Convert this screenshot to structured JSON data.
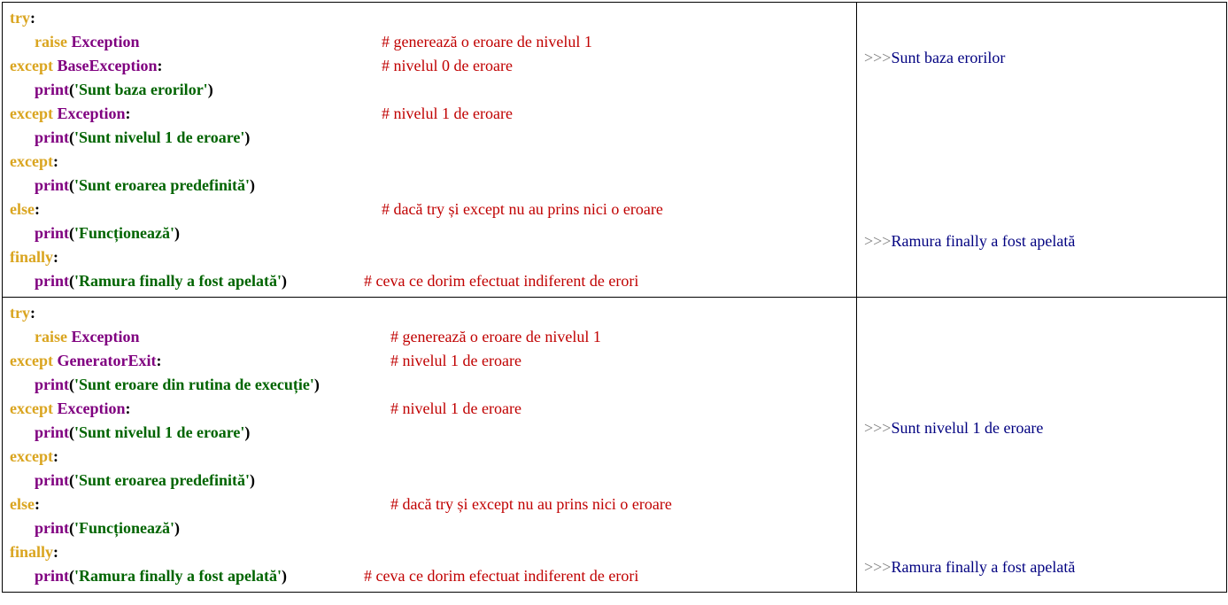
{
  "ex1": {
    "code": {
      "l1": {
        "kw": "try",
        "colon": ":"
      },
      "l2": {
        "kw": "raise",
        "exc": "Exception",
        "comment": "# generează o eroare de nivelul 1"
      },
      "l3": {
        "kw": "except",
        "exc": "BaseException",
        "colon": ":",
        "comment": "# nivelul 0 de eroare"
      },
      "l4": {
        "fn": "print",
        "open": "(",
        "str": "'Sunt baza erorilor'",
        "close": ")"
      },
      "l5": {
        "kw": "except",
        "exc": "Exception",
        "colon": ":",
        "comment": "# nivelul 1 de eroare"
      },
      "l6": {
        "fn": "print",
        "open": "(",
        "str": "'Sunt nivelul 1 de eroare'",
        "close": ")"
      },
      "l7": {
        "kw": "except",
        "colon": ":"
      },
      "l8": {
        "fn": "print",
        "open": "(",
        "str": "'Sunt eroarea predefinită'",
        "close": ")"
      },
      "l9": {
        "kw": "else",
        "colon": ":",
        "comment": "# dacă try și except nu au prins nici o eroare"
      },
      "l10": {
        "fn": "print",
        "open": "(",
        "str": "'Funcționează'",
        "close": ")"
      },
      "l11": {
        "kw": "finally",
        "colon": ":"
      },
      "l12": {
        "fn": "print",
        "open": "(",
        "str": "'Ramura finally a fost apelată'",
        "close": ")",
        "comment": "# ceva ce dorim efectuat indiferent de erori"
      }
    },
    "output": {
      "r1": {
        "prompt": ">>>",
        "text": "Sunt baza erorilor"
      },
      "r2": {
        "prompt": ">>>",
        "text": "Ramura finally a fost apelată"
      }
    }
  },
  "ex2": {
    "code": {
      "l1": {
        "kw": "try",
        "colon": ":"
      },
      "l2": {
        "kw": "raise",
        "exc": "Exception",
        "comment": "# generează o eroare de nivelul 1"
      },
      "l3": {
        "kw": "except",
        "exc": "GeneratorExit",
        "colon": ":",
        "comment": "# nivelul 1 de eroare"
      },
      "l4": {
        "fn": "print",
        "open": "(",
        "str": "'Sunt eroare din rutina de execuție'",
        "close": ")"
      },
      "l5": {
        "kw": "except",
        "exc": "Exception",
        "colon": ":",
        "comment": "# nivelul 1 de eroare"
      },
      "l6": {
        "fn": "print",
        "open": "(",
        "str": "'Sunt nivelul 1 de eroare'",
        "close": ")"
      },
      "l7": {
        "kw": "except",
        "colon": ":"
      },
      "l8": {
        "fn": "print",
        "open": "(",
        "str": "'Sunt eroarea predefinită'",
        "close": ")"
      },
      "l9": {
        "kw": "else",
        "colon": ":",
        "comment": "# dacă try și except nu au prins nici o eroare"
      },
      "l10": {
        "fn": "print",
        "open": "(",
        "str": "'Funcționează'",
        "close": ")"
      },
      "l11": {
        "kw": "finally",
        "colon": ":"
      },
      "l12": {
        "fn": "print",
        "open": "(",
        "str": "'Ramura finally a fost apelată'",
        "close": ")",
        "comment": "# ceva ce dorim efectuat indiferent de erori"
      }
    },
    "output": {
      "r1": {
        "prompt": ">>>",
        "text": "Sunt nivelul 1 de eroare"
      },
      "r2": {
        "prompt": ">>>",
        "text": "Ramura finally a fost apelată"
      }
    }
  }
}
